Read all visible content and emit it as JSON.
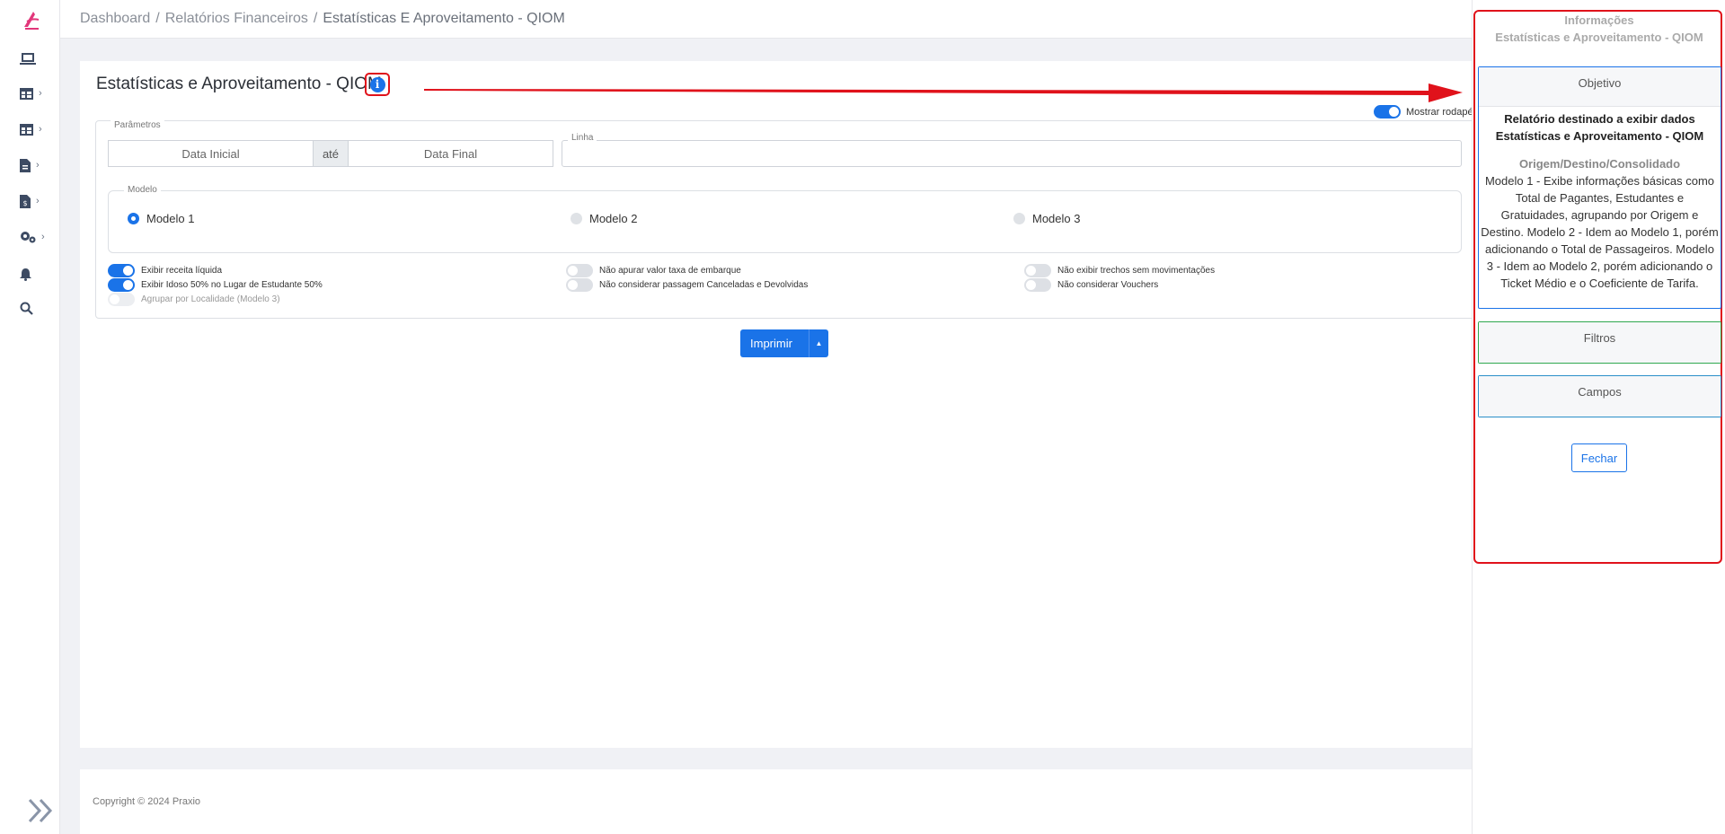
{
  "breadcrumb": {
    "items": [
      "Dashboard",
      "Relatórios Financeiros",
      "Estatísticas E Aproveitamento - QIOM"
    ],
    "separator": "/"
  },
  "page": {
    "title": "Estatísticas e Aproveitamento - QIOM",
    "info_icon": "info-circle-icon"
  },
  "params": {
    "legend": "Parâmetros",
    "mostrar_rodape": "Mostrar rodapé",
    "date_start_placeholder": "Data Inicial",
    "date_sep": "até",
    "date_end_placeholder": "Data Final",
    "linha_label": "Linha",
    "modelo_legend": "Modelo",
    "modelos": [
      "Modelo 1",
      "Modelo 2",
      "Modelo 3"
    ],
    "selected_modelo": "Modelo 1",
    "options": {
      "receita_liquida": "Exibir receita líquida",
      "idoso": "Exibir Idoso 50% no Lugar de Estudante 50%",
      "agrupar": "Agrupar por Localidade (Modelo 3)",
      "taxa_embarque": "Não apurar valor taxa de embarque",
      "canceladas": "Não considerar passagem Canceladas e Devolvidas",
      "trechos": "Não exibir trechos sem movimentações",
      "vouchers": "Não considerar Vouchers"
    }
  },
  "actions": {
    "print_label": "Imprimir"
  },
  "footer": {
    "copyright": "Copyright © 2024 Praxio"
  },
  "panel": {
    "title_line1": "Informações",
    "title_line2": "Estatísticas e Aproveitamento - QIOM",
    "objetivo_label": "Objetivo",
    "objetivo_heading": "Relatório destinado a exibir dados Estatísticas e Aproveitamento - QIOM",
    "objetivo_sub": "Origem/Destino/Consolidado",
    "objetivo_text": "Modelo 1 - Exibe informações básicas como Total de Pagantes, Estudantes e Gratuidades, agrupando por Origem e Destino. Modelo 2 - Idem ao Modelo 1, porém adicionando o Total de Passageiros. Modelo 3 - Idem ao Modelo 2, porém adicionando o Ticket Médio e o Coeficiente de Tarifa.",
    "filtros_label": "Filtros",
    "campos_label": "Campos",
    "fechar_label": "Fechar"
  },
  "colors": {
    "accent": "#1a73e8",
    "highlight": "#e0121b"
  }
}
